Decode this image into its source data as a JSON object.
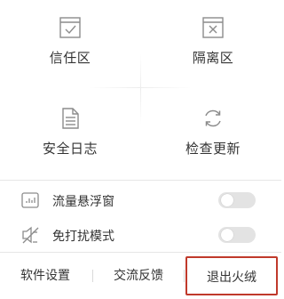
{
  "grid": {
    "tiles": [
      {
        "label": "信任区",
        "icon": "shield-check-icon"
      },
      {
        "label": "隔离区",
        "icon": "quarantine-box-icon"
      },
      {
        "label": "安全日志",
        "icon": "document-log-icon"
      },
      {
        "label": "检查更新",
        "icon": "refresh-icon"
      }
    ]
  },
  "toggles": [
    {
      "label": "流量悬浮窗",
      "icon": "traffic-chart-icon",
      "enabled": false
    },
    {
      "label": "免打扰模式",
      "icon": "do-not-disturb-icon",
      "enabled": false
    }
  ],
  "footer": {
    "settings_label": "软件设置",
    "feedback_label": "交流反馈",
    "exit_label": "退出火绒"
  },
  "colors": {
    "icon_stroke": "#8c8c8c",
    "toggle_off": "#e3e3e3",
    "highlight_border": "#c0392b"
  }
}
